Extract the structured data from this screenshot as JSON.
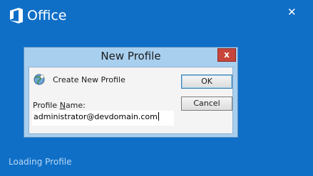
{
  "splash": {
    "brand": "Office",
    "close_glyph": "✕",
    "status": "Loading Profile",
    "background": "#0f6fc7",
    "logo_icon": "office-logo-icon"
  },
  "dialog": {
    "title": "New Profile",
    "close_glyph": "x",
    "create_label": "Create New Profile",
    "name_label_prefix": "Profile ",
    "name_label_mnemonic": "N",
    "name_label_suffix": "ame:",
    "name_value": "administrator@devdomain.com",
    "ok_label": "OK",
    "cancel_label": "Cancel",
    "profile_icon": "profile-globe-icon",
    "title_bar_color": "#a9cfee",
    "close_color": "#c7453a"
  }
}
